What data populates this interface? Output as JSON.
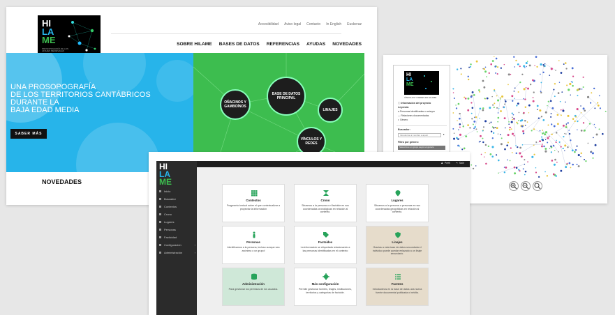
{
  "site": {
    "logo": {
      "lines": [
        "HI",
        "LA",
        "ME"
      ],
      "tagline": "PROSOPOGRAFÍA DE LOS LINAJES MEDIEVALES"
    },
    "top_links": [
      "Accesibilidad",
      "Aviso legal",
      "Contacto",
      "In English",
      "Euskeraz"
    ],
    "nav": [
      "SOBRE HILAME",
      "BASES DE DATOS",
      "REFERENCIAS",
      "AYUDAS",
      "NOVEDADES"
    ],
    "hero_lines": [
      "UNA PROSOPOGRAFÍA",
      "DE LOS TERRITORIOS CANTÁBRICOS",
      "DURANTE LA",
      "BAJA EDAD MEDIA"
    ],
    "cta": "SABER MÁS",
    "nodes": {
      "main": "BASE DE DATOS PRINCIPAL",
      "onacinos": "OÑACINOS Y GAMBOÍNOS",
      "linajes": "LINAJES",
      "vinculos": "VÍNCULOS Y REDES"
    },
    "section_heading": "NOVEDADES"
  },
  "network": {
    "logo_caption": "VÍNCULOS Y REDES EN HILAME",
    "info": "Información del proyecto",
    "legend_title": "Leyenda:",
    "legend_items": [
      "Personas identificadas o anónym",
      "Relaciones documentadas",
      "Género"
    ],
    "search_label": "Buscador:",
    "search_placeholder": "Introduzca un nombre a apunt",
    "filter_label": "Filtro por género:",
    "filter_value": "Seleccione un grupo según el género"
  },
  "admin": {
    "logo": [
      "HI",
      "LA",
      "ME"
    ],
    "menu": [
      {
        "label": "Inicio",
        "chev": ""
      },
      {
        "label": "Buscador",
        "chev": ""
      },
      {
        "label": "Contextos",
        "chev": ""
      },
      {
        "label": "Crono",
        "chev": ""
      },
      {
        "label": "Lugares",
        "chev": ""
      },
      {
        "label": "Personas",
        "chev": ""
      },
      {
        "label": "Facticidad",
        "chev": ""
      },
      {
        "label": "Configuración",
        "chev": "›"
      },
      {
        "label": "Administración",
        "chev": "›"
      }
    ],
    "top_right": [
      "Perfil",
      "Salir"
    ],
    "tiles": [
      {
        "title": "Contextos",
        "desc": "Fragmento textual sobre el que contextualizar a proyectar la información",
        "bg": "#ffffff",
        "icon": "grid-icon",
        "color": "#27a35a"
      },
      {
        "title": "Crono",
        "desc": "Situamos a la persona o el factoide en sus coordenadas cronológicas en relación al contexto.",
        "bg": "#ffffff",
        "icon": "hourglass-icon",
        "color": "#27a35a"
      },
      {
        "title": "Lugares",
        "desc": "Situamos a la persona o personas en sus coordenadas geográficas en relación al contexto.",
        "bg": "#ffffff",
        "icon": "map-pin-icon",
        "color": "#27a35a"
      },
      {
        "title": "Personas",
        "desc": "Identificamos a la persona, incluso aunque sea anónima o un grupo!",
        "bg": "#ffffff",
        "icon": "person-icon",
        "color": "#27a35a"
      },
      {
        "title": "Factoides",
        "desc": "La información se etiquetada relacionando a las personas identificadas en el contexto",
        "bg": "#ffffff",
        "icon": "tags-icon",
        "color": "#27a35a"
      },
      {
        "title": "Linajes",
        "desc": "Gracias a esta base de datos secundaria el individuo puede quedar enlazado a un linaje secundario.",
        "bg": "#e6dccb",
        "icon": "shield-icon",
        "color": "#27a35a"
      },
      {
        "title": "Administración",
        "desc": "Para gestionar los permisos de los usuarios.",
        "bg": "#cfe8d8",
        "icon": "database-icon",
        "color": "#27a35a"
      },
      {
        "title": "Más configuración",
        "desc": "Permite gestionar fuentes, linajes, instituciones, territorios y categorías de factoide.",
        "bg": "#ffffff",
        "icon": "gear-icon",
        "color": "#27a35a"
      },
      {
        "title": "Fuentes",
        "desc": "Introducimos en la base de datos una nueva fuente documental publicada o inédita.",
        "bg": "#e6dccb",
        "icon": "list-icon",
        "color": "#27a35a"
      }
    ]
  }
}
